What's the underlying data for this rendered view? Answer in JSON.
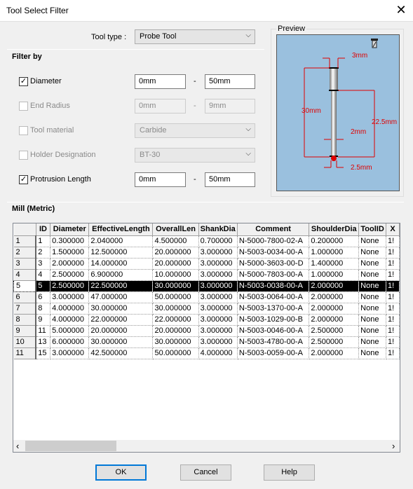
{
  "window": {
    "title": "Tool Select Filter",
    "close_icon": "close-icon"
  },
  "tool_type": {
    "label": "Tool type :",
    "value": "Probe Tool"
  },
  "filter": {
    "heading": "Filter by",
    "dash": "-",
    "rows": [
      {
        "label": "Diameter",
        "checked": true,
        "enabled": true,
        "min": "0mm",
        "max": "50mm"
      },
      {
        "label": "End Radius",
        "checked": false,
        "enabled": false,
        "min": "0mm",
        "max": "9mm"
      },
      {
        "label": "Tool material",
        "checked": false,
        "enabled": false,
        "select": "Carbide"
      },
      {
        "label": "Holder Designation",
        "checked": false,
        "enabled": false,
        "select": "BT-30"
      },
      {
        "label": "Protrusion Length",
        "checked": true,
        "enabled": true,
        "min": "0mm",
        "max": "50mm"
      }
    ]
  },
  "preview": {
    "label": "Preview",
    "dims": {
      "top_dia": "3mm",
      "overall": "30mm",
      "effective": "22.5mm",
      "shank": "2mm",
      "ball": "2.5mm"
    },
    "tool_color": "#ff0000",
    "bg": "#9ac0de"
  },
  "table": {
    "heading": "Mill (Metric)",
    "columns": [
      "",
      "ID",
      "Diameter",
      "EffectiveLength",
      "OverallLen",
      "ShankDia",
      "Comment",
      "ShoulderDia",
      "ToolID",
      "X"
    ],
    "selected_row": 5,
    "rows": [
      [
        "1",
        "1",
        "0.300000",
        "2.040000",
        "4.500000",
        "0.700000",
        "N-5000-7800-02-A",
        "0.200000",
        "None",
        "1!"
      ],
      [
        "2",
        "2",
        "1.500000",
        "12.500000",
        "20.000000",
        "3.000000",
        "N-5003-0034-00-A",
        "1.000000",
        "None",
        "1!"
      ],
      [
        "3",
        "3",
        "2.000000",
        "14.000000",
        "20.000000",
        "3.000000",
        "N-5000-3603-00-D",
        "1.400000",
        "None",
        "1!"
      ],
      [
        "4",
        "4",
        "2.500000",
        "6.900000",
        "10.000000",
        "3.000000",
        "N-5000-7803-00-A",
        "1.000000",
        "None",
        "1!"
      ],
      [
        "5",
        "5",
        "2.500000",
        "22.500000",
        "30.000000",
        "3.000000",
        "N-5003-0038-00-A",
        "2.000000",
        "None",
        "1!"
      ],
      [
        "6",
        "6",
        "3.000000",
        "47.000000",
        "50.000000",
        "3.000000",
        "N-5003-0064-00-A",
        "2.000000",
        "None",
        "1!"
      ],
      [
        "7",
        "8",
        "4.000000",
        "30.000000",
        "30.000000",
        "3.000000",
        "N-5003-1370-00-A",
        "2.000000",
        "None",
        "1!"
      ],
      [
        "8",
        "9",
        "4.000000",
        "22.000000",
        "22.000000",
        "3.000000",
        "N-5003-1029-00-B",
        "2.000000",
        "None",
        "1!"
      ],
      [
        "9",
        "11",
        "5.000000",
        "20.000000",
        "20.000000",
        "3.000000",
        "N-5003-0046-00-A",
        "2.500000",
        "None",
        "1!"
      ],
      [
        "10",
        "13",
        "6.000000",
        "30.000000",
        "30.000000",
        "3.000000",
        "N-5003-4780-00-A",
        "2.500000",
        "None",
        "1!"
      ],
      [
        "11",
        "15",
        "3.000000",
        "42.500000",
        "50.000000",
        "4.000000",
        "N-5003-0059-00-A",
        "2.000000",
        "None",
        "1!"
      ]
    ]
  },
  "scroll": {
    "left": "‹",
    "right": "›"
  },
  "buttons": {
    "ok": "OK",
    "cancel": "Cancel",
    "help": "Help"
  }
}
